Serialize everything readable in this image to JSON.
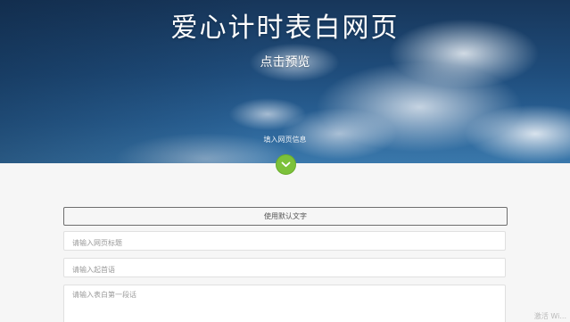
{
  "hero": {
    "title": "爱心计时表白网页",
    "preview_link": "点击预览",
    "info_label": "填入网页信息"
  },
  "form": {
    "default_text_button": "使用默认文字",
    "title_placeholder": "请输入网页标题",
    "opening_placeholder": "请输入起首语",
    "paragraph_placeholder": "请输入表白第一段话"
  },
  "watermark": "激活 Wi...",
  "colors": {
    "accent_green": "#7cc13a",
    "sky_dark": "#17365a"
  },
  "icons": {
    "scroll": "chevron-down-icon"
  }
}
